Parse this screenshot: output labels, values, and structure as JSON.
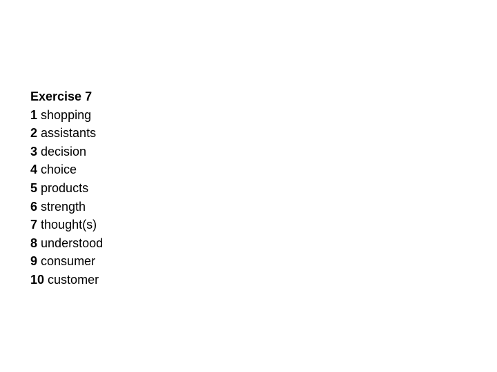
{
  "exercise": {
    "title": "Exercise 7",
    "answers": [
      {
        "number": "1",
        "word": "shopping"
      },
      {
        "number": "2",
        "word": "assistants"
      },
      {
        "number": "3",
        "word": "decision"
      },
      {
        "number": "4",
        "word": "choice"
      },
      {
        "number": "5",
        "word": "products"
      },
      {
        "number": "6",
        "word": "strength"
      },
      {
        "number": "7",
        "word": "thought(s)"
      },
      {
        "number": "8",
        "word": "understood"
      },
      {
        "number": "9",
        "word": "consumer"
      },
      {
        "number": "10",
        "word": "customer"
      }
    ]
  }
}
